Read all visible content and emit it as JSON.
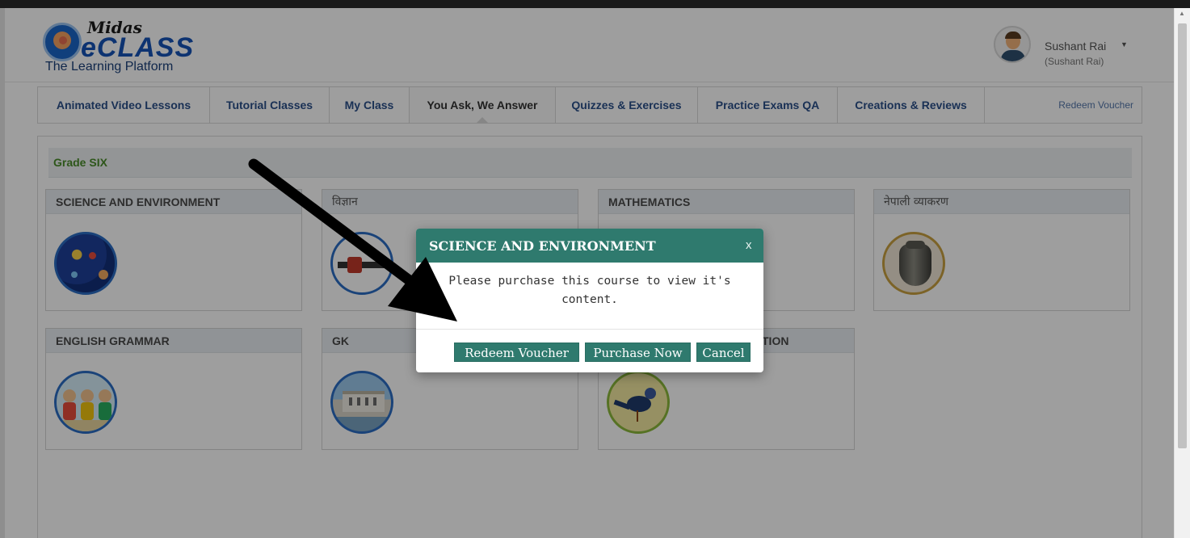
{
  "brand": {
    "logo_top": "Midas",
    "logo_main": "eCLASS",
    "tagline": "The Learning Platform"
  },
  "user": {
    "name": "Sushant Rai",
    "sub": "(Sushant Rai)"
  },
  "nav": {
    "items": [
      {
        "label": "Animated Video Lessons"
      },
      {
        "label": "Tutorial Classes"
      },
      {
        "label": "My Class"
      },
      {
        "label": "You Ask, We Answer"
      },
      {
        "label": "Quizzes & Exercises"
      },
      {
        "label": "Practice Exams QA"
      },
      {
        "label": "Creations & Reviews"
      }
    ],
    "active": "You Ask, We Answer",
    "redeem_label": "Redeem Voucher"
  },
  "grade": {
    "title": "Grade SIX"
  },
  "subjects": [
    {
      "title": "SCIENCE AND ENVIRONMENT",
      "icon": "solar-system-icon"
    },
    {
      "title": "विज्ञान",
      "icon": "magnet-icon"
    },
    {
      "title": "MATHEMATICS",
      "icon": "math-icon"
    },
    {
      "title": "नेपाली व्याकरण",
      "icon": "vase-icon"
    },
    {
      "title": "ENGLISH GRAMMAR",
      "icon": "kids-icon"
    },
    {
      "title": "GK",
      "icon": "palace-icon"
    },
    {
      "title": "TION",
      "icon": "bird-icon"
    }
  ],
  "modal": {
    "title": "SCIENCE AND ENVIRONMENT",
    "close": "x",
    "message_line1": "Please purchase this course to view it's",
    "message_line2": "content.",
    "buttons": {
      "redeem": "Redeem Voucher",
      "purchase": "Purchase Now",
      "cancel": "Cancel"
    },
    "accent": "#2f7a6e"
  },
  "colors": {
    "nav_text": "#2a4f8a",
    "grade_text": "#4a8c2a",
    "overlay": "rgba(0,0,0,0.38)"
  }
}
